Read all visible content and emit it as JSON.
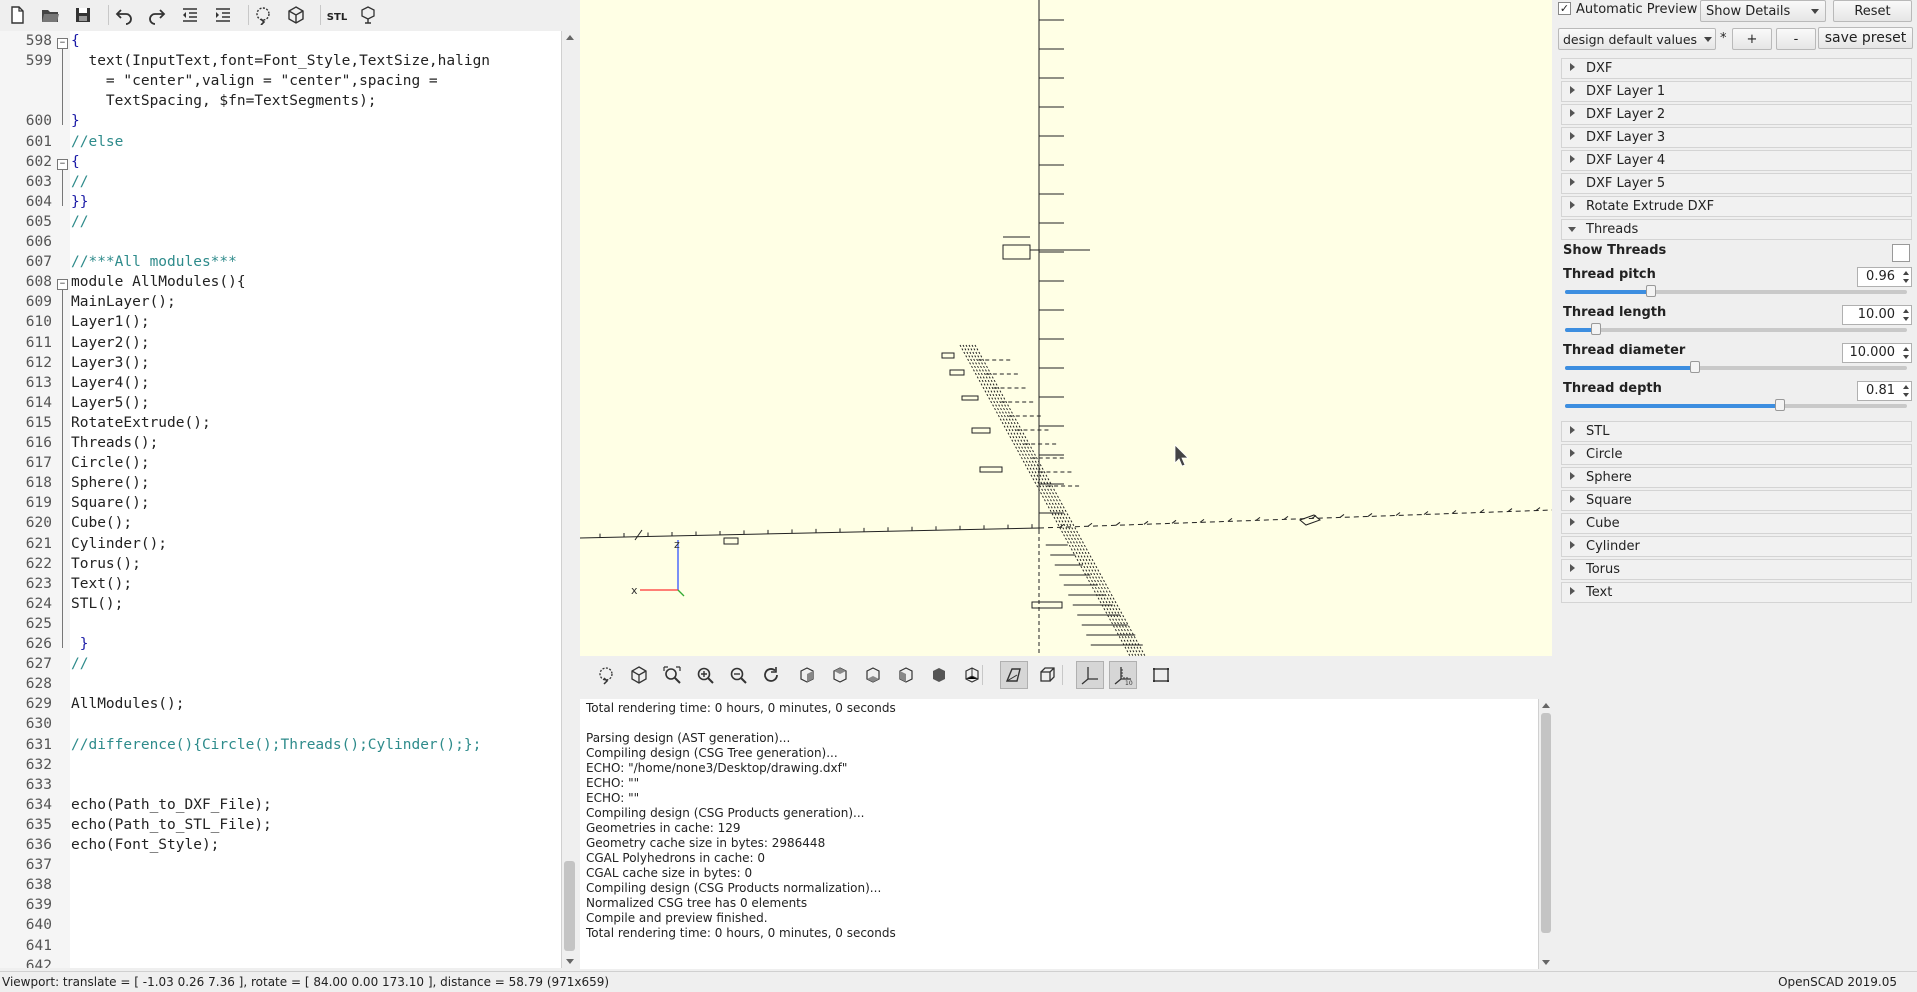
{
  "app": {
    "name": "OpenSCAD 2019.05"
  },
  "toolbar": {
    "icons": [
      "new-file-icon",
      "open-file-icon",
      "save-icon",
      "undo-icon",
      "redo-icon",
      "unindent-icon",
      "indent-icon",
      "preview-icon",
      "render-icon",
      "export-stl-icon",
      "send-to-3d-print-icon"
    ],
    "stl_label": "STL"
  },
  "editor": {
    "lines": [
      {
        "n": "598",
        "code": "{"
      },
      {
        "n": "599",
        "code": "  text(InputText,font=Font_Style,TextSize,halign"
      },
      {
        "n": "",
        "code": "    = \"center\",valign = \"center\",spacing ="
      },
      {
        "n": "",
        "code": "    TextSpacing, $fn=TextSegments);"
      },
      {
        "n": "600",
        "code": "}"
      },
      {
        "n": "601",
        "code": "//else"
      },
      {
        "n": "602",
        "code": "{"
      },
      {
        "n": "603",
        "code": "//"
      },
      {
        "n": "604",
        "code": "}}"
      },
      {
        "n": "605",
        "code": "//"
      },
      {
        "n": "606",
        "code": ""
      },
      {
        "n": "607",
        "code": "//***All modules***"
      },
      {
        "n": "608",
        "code": "module AllModules(){"
      },
      {
        "n": "609",
        "code": "MainLayer();"
      },
      {
        "n": "610",
        "code": "Layer1();"
      },
      {
        "n": "611",
        "code": "Layer2();"
      },
      {
        "n": "612",
        "code": "Layer3();"
      },
      {
        "n": "613",
        "code": "Layer4();"
      },
      {
        "n": "614",
        "code": "Layer5();"
      },
      {
        "n": "615",
        "code": "RotateExtrude();"
      },
      {
        "n": "616",
        "code": "Threads();"
      },
      {
        "n": "617",
        "code": "Circle();"
      },
      {
        "n": "618",
        "code": "Sphere();"
      },
      {
        "n": "619",
        "code": "Square();"
      },
      {
        "n": "620",
        "code": "Cube();"
      },
      {
        "n": "621",
        "code": "Cylinder();"
      },
      {
        "n": "622",
        "code": "Torus();"
      },
      {
        "n": "623",
        "code": "Text();"
      },
      {
        "n": "624",
        "code": "STL();"
      },
      {
        "n": "625",
        "code": ""
      },
      {
        "n": "626",
        "code": " }"
      },
      {
        "n": "627",
        "code": "//"
      },
      {
        "n": "628",
        "code": ""
      },
      {
        "n": "629",
        "code": "AllModules();"
      },
      {
        "n": "630",
        "code": ""
      },
      {
        "n": "631",
        "code": "//difference(){Circle();Threads();Cylinder();};"
      },
      {
        "n": "632",
        "code": ""
      },
      {
        "n": "633",
        "code": ""
      },
      {
        "n": "634",
        "code": "echo(Path_to_DXF_File);"
      },
      {
        "n": "635",
        "code": "echo(Path_to_STL_File);"
      },
      {
        "n": "636",
        "code": "echo(Font_Style);"
      },
      {
        "n": "637",
        "code": ""
      },
      {
        "n": "638",
        "code": ""
      },
      {
        "n": "639",
        "code": ""
      },
      {
        "n": "640",
        "code": ""
      },
      {
        "n": "641",
        "code": ""
      },
      {
        "n": "642",
        "code": ""
      }
    ]
  },
  "viewport": {
    "axes": {
      "z": "z",
      "x": "x"
    }
  },
  "view_toolbar": {
    "icons": [
      "preview-icon",
      "render-icon",
      "view-all-icon",
      "zoom-in-icon",
      "zoom-out-icon",
      "reset-view-icon",
      "view-right-icon",
      "view-top-icon",
      "view-bottom-icon",
      "view-left-icon",
      "view-front-icon",
      "view-back-icon",
      "perspective-icon",
      "orthogonal-icon",
      "show-axes-icon",
      "show-scale-markers-icon",
      "show-edges-icon"
    ]
  },
  "console": {
    "lines": [
      "Total rendering time: 0 hours, 0 minutes, 0 seconds",
      "",
      "Parsing design (AST generation)...",
      "Compiling design (CSG Tree generation)...",
      "ECHO: \"/home/none3/Desktop/drawing.dxf\"",
      "ECHO: \"\"",
      "ECHO: \"\"",
      "Compiling design (CSG Products generation)...",
      "Geometries in cache: 129",
      "Geometry cache size in bytes: 2986448",
      "CGAL Polyhedrons in cache: 0",
      "CGAL cache size in bytes: 0",
      "Compiling design (CSG Products normalization)...",
      "Normalized CSG tree has 0 elements",
      "Compile and preview finished.",
      "Total rendering time: 0 hours, 0 minutes, 0 seconds"
    ]
  },
  "customizer": {
    "automatic_preview_label": "Automatic Preview",
    "automatic_preview_checked": true,
    "detail_select": "Show Details",
    "reset_label": "Reset",
    "preset_select": "design default values",
    "preset_modified": "*",
    "plus_label": "+",
    "minus_label": "-",
    "save_preset_label": "save preset",
    "sections_top": [
      "DXF",
      "DXF Layer 1",
      "DXF Layer 2",
      "DXF Layer 3",
      "DXF Layer 4",
      "DXF Layer 5",
      "Rotate Extrude DXF"
    ],
    "open_section": "Threads",
    "show_threads_label": "Show Threads",
    "params": [
      {
        "label": "Thread pitch",
        "value": "0.96",
        "fraction": 0.25
      },
      {
        "label": "Thread length",
        "value": "10.00",
        "fraction": 0.09
      },
      {
        "label": "Thread diameter",
        "value": "10.000",
        "fraction": 0.38
      },
      {
        "label": "Thread depth",
        "value": "0.81",
        "fraction": 0.63
      }
    ],
    "sections_bottom": [
      "STL",
      "Circle",
      "Sphere",
      "Square",
      "Cube",
      "Cylinder",
      "Torus",
      "Text"
    ]
  },
  "status": {
    "viewport_info": "Viewport: translate = [ -1.03 0.26 7.36 ], rotate = [ 84.00 0.00 173.10 ], distance = 58.79 (971x659)",
    "version": "OpenSCAD 2019.05"
  }
}
